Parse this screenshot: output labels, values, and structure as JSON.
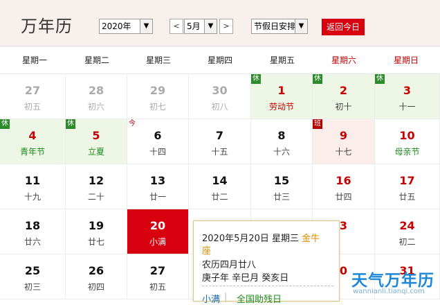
{
  "app_title": "万年历",
  "controls": {
    "year_select": "2020年",
    "prev_label": "<",
    "month_select": "5月",
    "next_label": ">",
    "holiday_select": "节假日安排",
    "today_button": "返回今日",
    "dropdown_arrow": "▼"
  },
  "weekdays": [
    "星期一",
    "星期二",
    "星期三",
    "星期四",
    "星期五",
    "星期六",
    "星期日"
  ],
  "weekend_color": "#c40000",
  "accent_color": "#d8000f",
  "rest_badge_label": "休",
  "work_badge_label": "班",
  "today_badge_label": "今",
  "weeks": [
    [
      {
        "day": "27",
        "lunar": "初五",
        "type": "other"
      },
      {
        "day": "28",
        "lunar": "初六",
        "type": "other"
      },
      {
        "day": "29",
        "lunar": "初七",
        "type": "other"
      },
      {
        "day": "30",
        "lunar": "初八",
        "type": "other"
      },
      {
        "day": "1",
        "lunar": "劳动节",
        "type": "rest",
        "badge": "rest"
      },
      {
        "day": "2",
        "lunar": "初十",
        "type": "rest",
        "badge": "rest"
      },
      {
        "day": "3",
        "lunar": "十一",
        "type": "rest",
        "badge": "rest"
      }
    ],
    [
      {
        "day": "4",
        "lunar": "青年节",
        "type": "rest",
        "badge": "rest"
      },
      {
        "day": "5",
        "lunar": "立夏",
        "type": "rest",
        "badge": "rest"
      },
      {
        "day": "6",
        "lunar": "十四",
        "type": "normal",
        "badge": "today"
      },
      {
        "day": "7",
        "lunar": "十五",
        "type": "normal"
      },
      {
        "day": "8",
        "lunar": "十六",
        "type": "normal"
      },
      {
        "day": "9",
        "lunar": "十七",
        "type": "work",
        "badge": "work"
      },
      {
        "day": "10",
        "lunar": "母亲节",
        "type": "normal"
      }
    ],
    [
      {
        "day": "11",
        "lunar": "十九",
        "type": "normal"
      },
      {
        "day": "12",
        "lunar": "二十",
        "type": "normal"
      },
      {
        "day": "13",
        "lunar": "廿一",
        "type": "normal"
      },
      {
        "day": "14",
        "lunar": "廿二",
        "type": "normal"
      },
      {
        "day": "15",
        "lunar": "廿三",
        "type": "normal"
      },
      {
        "day": "16",
        "lunar": "廿四",
        "type": "normal"
      },
      {
        "day": "17",
        "lunar": "廿五",
        "type": "normal"
      }
    ],
    [
      {
        "day": "18",
        "lunar": "廿六",
        "type": "normal"
      },
      {
        "day": "19",
        "lunar": "廿七",
        "type": "normal"
      },
      {
        "day": "20",
        "lunar": "小满",
        "type": "today"
      },
      {
        "day": "",
        "lunar": "",
        "type": "normal"
      },
      {
        "day": "",
        "lunar": "",
        "type": "normal"
      },
      {
        "day": "3",
        "lunar": "",
        "type": "normal"
      },
      {
        "day": "24",
        "lunar": "初二",
        "type": "normal"
      }
    ],
    [
      {
        "day": "25",
        "lunar": "初三",
        "type": "normal"
      },
      {
        "day": "26",
        "lunar": "初四",
        "type": "normal"
      },
      {
        "day": "27",
        "lunar": "初五",
        "type": "normal"
      },
      {
        "day": "",
        "lunar": "",
        "type": "normal"
      },
      {
        "day": "",
        "lunar": "",
        "type": "normal"
      },
      {
        "day": "0",
        "lunar": "",
        "type": "normal"
      },
      {
        "day": "31",
        "lunar": "",
        "type": "normal"
      }
    ]
  ],
  "popup": {
    "date_line": "2020年5月20日 星期三",
    "zodiac_line1": "金牛",
    "zodiac_line2": "座",
    "lunar_line": "农历四月廿八",
    "ganzhi_line": "庚子年 辛巳月 癸亥日",
    "term_link": "小满",
    "divider": "|",
    "festival_link": "全国助残日",
    "link_color": "#1a6fb3",
    "festival_color": "#1c8a1c"
  },
  "watermark": {
    "brand": "天气万年历",
    "url": "wannianli.tianqi.com"
  }
}
